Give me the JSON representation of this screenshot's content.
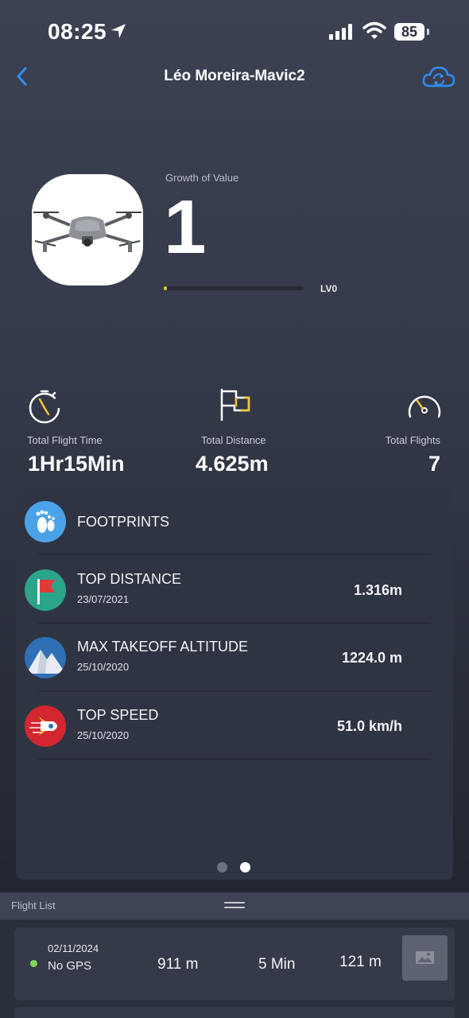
{
  "status_bar": {
    "time": "08:25",
    "battery": "85"
  },
  "nav": {
    "title": "Léo Moreira-Mavic2"
  },
  "hero": {
    "growth_label": "Growth of Value",
    "growth_value": "1",
    "level_label": "LV0",
    "level_progress": 0.02
  },
  "stats": [
    {
      "label": "Total Flight Time",
      "value": "1Hr15Min",
      "icon": "stopwatch-icon"
    },
    {
      "label": "Total Distance",
      "value": "4.625m",
      "icon": "flag-icon"
    },
    {
      "label": "Total Flights",
      "value": "7",
      "icon": "speedometer-icon"
    }
  ],
  "records": [
    {
      "title": "FOOTPRINTS",
      "date": "",
      "value": "",
      "icon": "footprints-icon"
    },
    {
      "title": "TOP DISTANCE",
      "date": "23/07/2021",
      "value": "1.316m",
      "icon": "red-flag-icon"
    },
    {
      "title": "MAX TAKEOFF ALTITUDE",
      "date": "25/10/2020",
      "value": "1224.0 m",
      "icon": "mountain-icon"
    },
    {
      "title": "TOP SPEED",
      "date": "25/10/2020",
      "value": "51.0 km/h",
      "icon": "rocket-icon"
    }
  ],
  "pager": {
    "pages": 2,
    "active": 1
  },
  "flight_list": {
    "title": "Flight List",
    "items": [
      {
        "date": "02/11/2024",
        "gps": "No GPS",
        "distance": "911 m",
        "duration": "5 Min",
        "altitude": "121 m",
        "status_color": "#7ed957"
      }
    ]
  },
  "colors": {
    "accent": "#2f8df0",
    "gold": "#f5c531",
    "card": "#2f3443"
  }
}
